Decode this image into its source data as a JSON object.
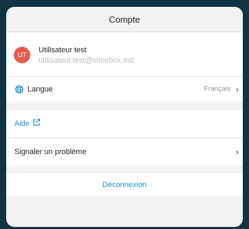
{
  "header": {
    "title": "Compte"
  },
  "profile": {
    "avatar_initials": "UT",
    "name": "Utilisateur test",
    "email": "utilisateur.test@shoebox.md"
  },
  "language": {
    "label": "Langue",
    "value": "Français",
    "icon": "globe-icon"
  },
  "help": {
    "label": "Aide",
    "icon": "external-link-icon"
  },
  "report": {
    "label": "Signaler un problème"
  },
  "logout": {
    "label": "Déconnexion"
  },
  "colors": {
    "accent": "#1f8fce",
    "avatar_bg": "#e85a4f",
    "backdrop": "#0f3446",
    "sheet_bg": "#f1f2f4"
  }
}
